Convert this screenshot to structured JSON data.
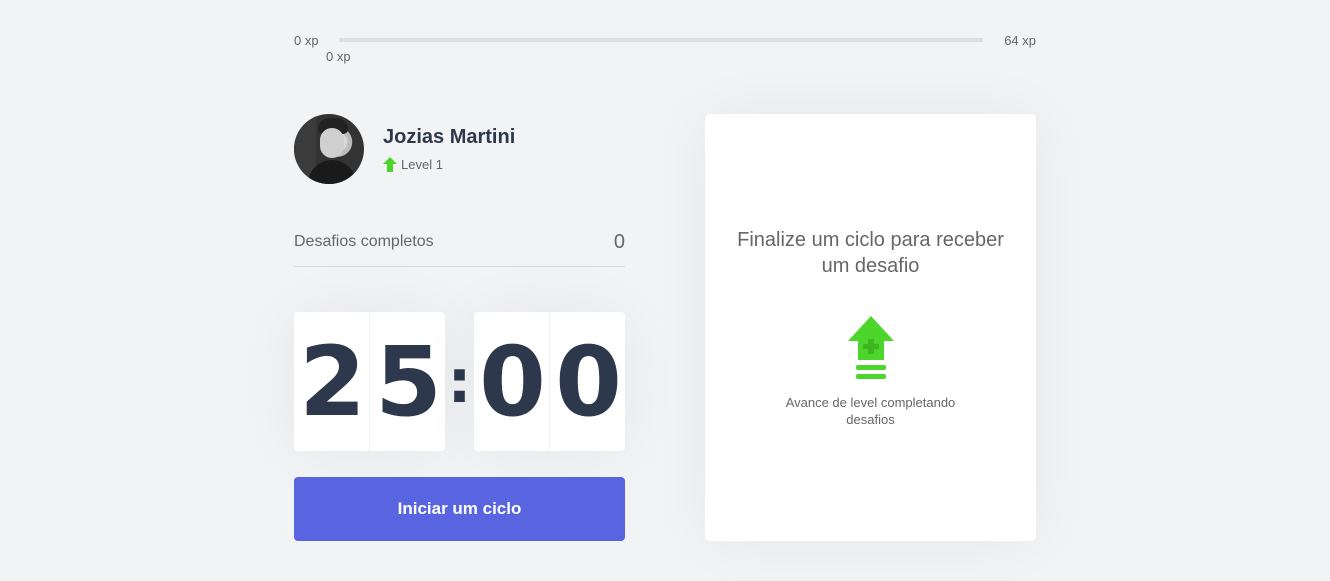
{
  "experience": {
    "min_label": "0 xp",
    "max_label": "64 xp",
    "current_label": "0 xp",
    "progress": 0
  },
  "profile": {
    "name": "Jozias Martini",
    "level_label": "Level 1",
    "level_icon": "level-up-arrow-icon"
  },
  "completed_challenges": {
    "label": "Desafios completos",
    "value": "0"
  },
  "countdown": {
    "minute_left": "2",
    "minute_right": "5",
    "separator": ":",
    "second_left": "0",
    "second_right": "0"
  },
  "start_button": {
    "label": "Iniciar um ciclo"
  },
  "challenge_box": {
    "title": "Finalize um ciclo para receber um desafio",
    "icon": "level-up-icon",
    "hint": "Avance de level completando desafios"
  },
  "colors": {
    "background": "#f2f3f5",
    "accent_blue": "#5965e0",
    "green": "#4cd62b",
    "title": "#2e384d",
    "text": "#666666"
  }
}
